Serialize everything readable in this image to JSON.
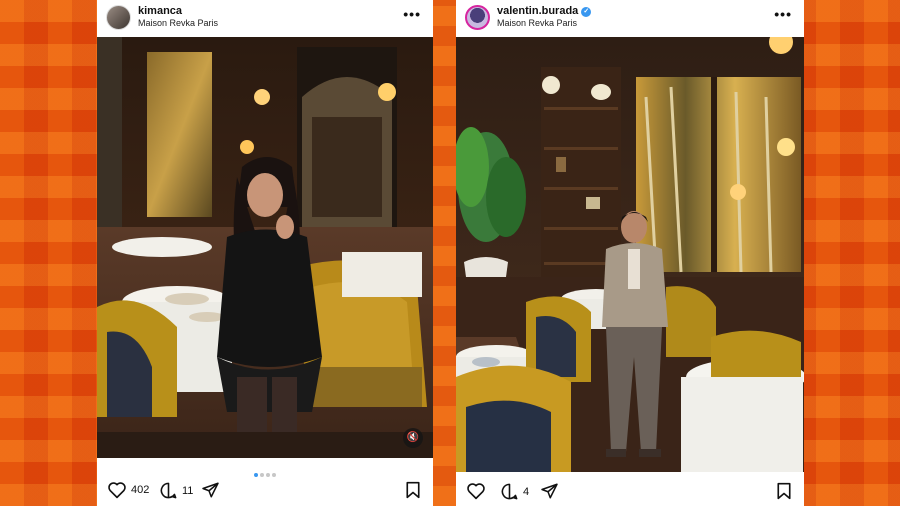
{
  "posts": [
    {
      "username": "kimanca",
      "verified": false,
      "location": "Maison Revka Paris",
      "likes": "402",
      "comments": "11",
      "carousel_dots": 4,
      "carousel_active": 0,
      "has_mute_icon": true
    },
    {
      "username": "valentin.burada",
      "verified": true,
      "location": "Maison Revka Paris",
      "likes": "",
      "comments": "4",
      "has_mute_icon": false
    }
  ],
  "colors": {
    "background": "#e8530f",
    "verified_blue": "#3897f0",
    "carousel_active": "#3897f0"
  },
  "icons": [
    "heart-icon",
    "comment-icon",
    "share-icon",
    "bookmark-icon",
    "more-icon",
    "mute-icon",
    "verified-badge-icon"
  ]
}
